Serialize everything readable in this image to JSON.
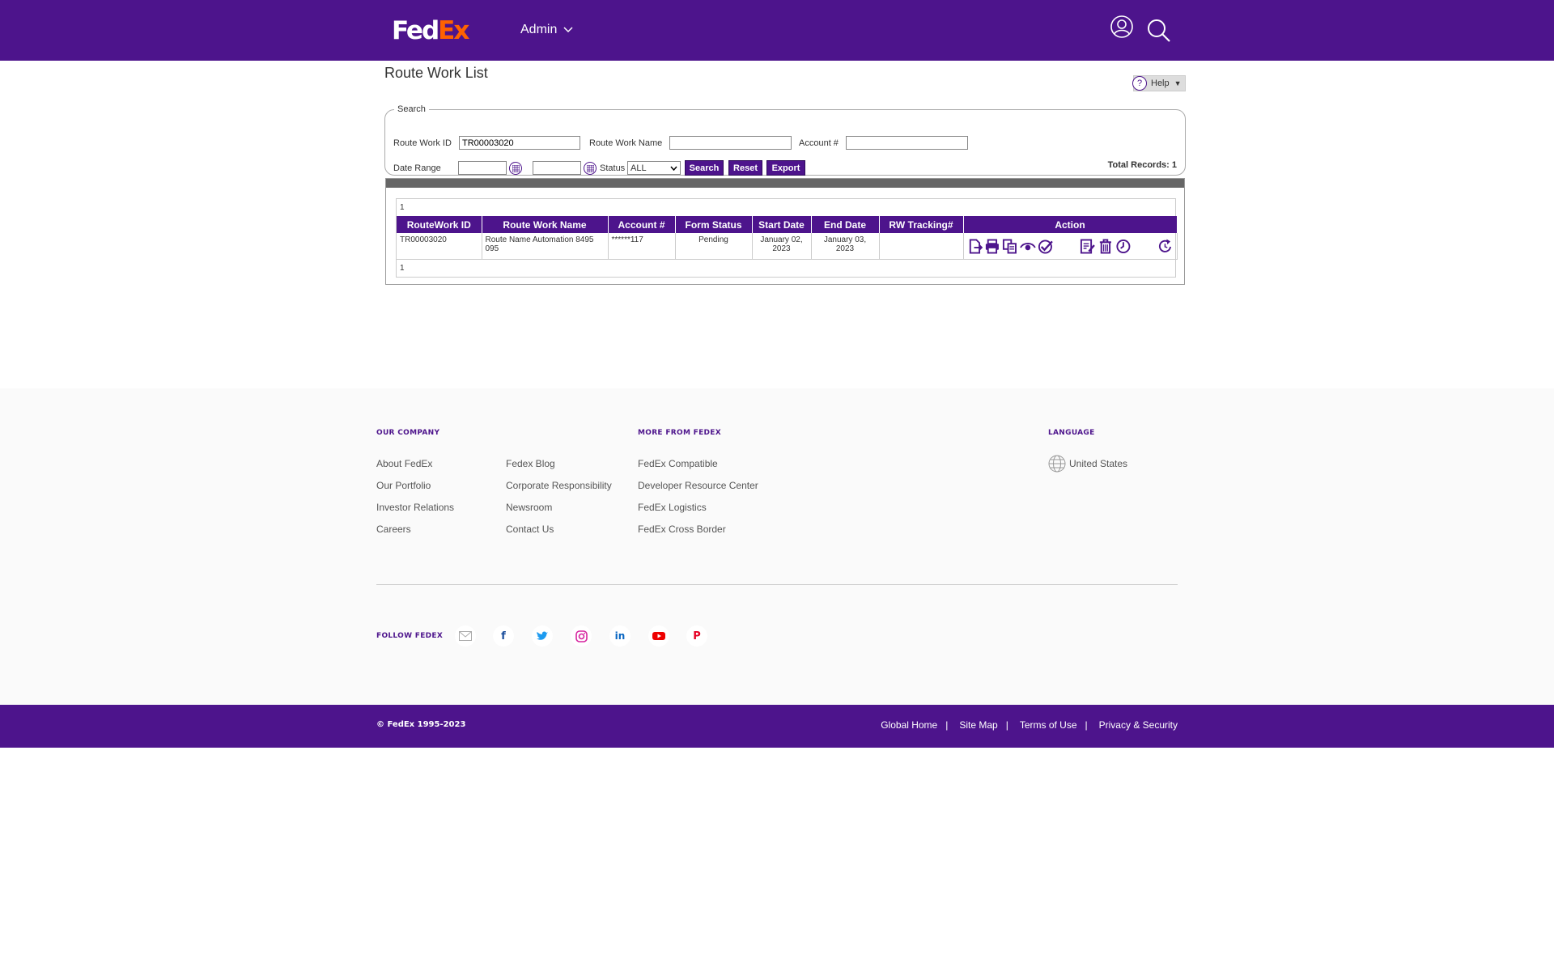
{
  "header": {
    "logo_fed": "Fed",
    "logo_ex": "Ex",
    "menu_label": "Admin"
  },
  "page": {
    "title": "Route Work List",
    "help_label": "Help"
  },
  "search": {
    "legend": "Search",
    "route_work_id_label": "Route Work ID",
    "route_work_id_value": "TR00003020",
    "route_work_name_label": "Route Work Name",
    "route_work_name_value": "",
    "account_label": "Account #",
    "account_value": "",
    "date_range_label": "Date Range",
    "date_from": "",
    "date_to": "",
    "status_label": "Status",
    "status_value": "ALL",
    "search_btn": "Search",
    "reset_btn": "Reset",
    "export_btn": "Export",
    "total_records": "Total Records: 1"
  },
  "results": {
    "pager_top": "1",
    "pager_bottom": "1",
    "columns": [
      "RouteWork ID",
      "Route Work Name",
      "Account #",
      "Form Status",
      "Start Date",
      "End Date",
      "RW Tracking#",
      "Action"
    ],
    "rows": [
      {
        "id": "TR00003020",
        "name": "Route Name Automation 8495 095",
        "account": "******117",
        "status": "Pending",
        "start": "January 02, 2023",
        "end": "January 03, 2023",
        "tracking": "",
        "actions": [
          "export-icon",
          "print-icon",
          "copy-icon",
          "view-icon",
          "approve-icon",
          "edit-icon",
          "delete-icon",
          "history-icon",
          "refresh-icon"
        ]
      }
    ]
  },
  "footer": {
    "our_company": {
      "heading": "OUR COMPANY",
      "col1": [
        "About FedEx",
        "Our Portfolio",
        "Investor Relations",
        "Careers"
      ],
      "col2": [
        "Fedex Blog",
        "Corporate Responsibility",
        "Newsroom",
        "Contact Us"
      ]
    },
    "more_from_fedex": {
      "heading": "MORE FROM FEDEX",
      "links": [
        "FedEx Compatible",
        "Developer Resource Center",
        "FedEx Logistics",
        "FedEx Cross Border"
      ]
    },
    "language": {
      "heading": "LANGUAGE",
      "value": "United States"
    },
    "follow": {
      "heading": "FOLLOW FEDEX",
      "icons": [
        "email-icon",
        "facebook-icon",
        "twitter-icon",
        "instagram-icon",
        "linkedin-icon",
        "youtube-icon",
        "pinterest-icon"
      ]
    },
    "copyright": "© FedEx 1995-2023",
    "bottom_links": [
      "Global Home",
      "Site Map",
      "Terms of Use",
      "Privacy & Security"
    ],
    "separator": "|"
  },
  "colors": {
    "brand_purple": "#4d148c",
    "brand_orange": "#ff6200"
  }
}
